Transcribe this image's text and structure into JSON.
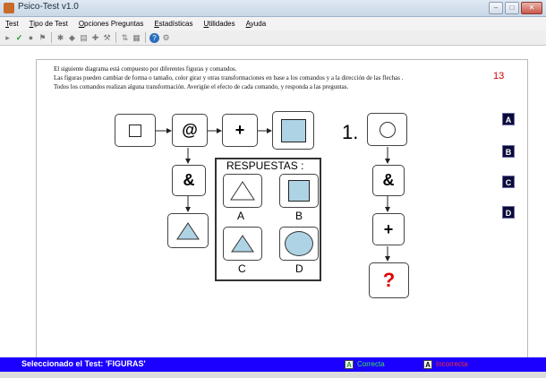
{
  "window": {
    "title": "Psico-Test v1.0"
  },
  "menu": [
    "Test",
    "Tipo de Test",
    "Opciones Preguntas",
    "Estadísticas",
    "Utilidades",
    "Ayuda"
  ],
  "instructions": [
    "El siguiente diagrama está compuesto por diferentes figuras y comandos.",
    "Las figuras pueden cambiar de forma o tamaño, color girar y otras transformaciones en base a los comandos y a la dirección de las flechas .",
    "Todos los comandos realizan alguna transformación. Averigüe el efecto de cada comando, y responda a las preguntas."
  ],
  "question_number": "13",
  "diagram": {
    "cmd_at": "@",
    "cmd_plus": "+",
    "cmd_amp": "&",
    "question_label": "1.",
    "question_mark": "?"
  },
  "answers": {
    "title": "RESPUESTAS :",
    "labels": [
      "A",
      "B",
      "C",
      "D"
    ]
  },
  "side_buttons": [
    "A",
    "B",
    "C",
    "D"
  ],
  "status": {
    "text": "Seleccionado el Test: 'FIGURAS'",
    "correct_icon": "A",
    "correct_label": "Correcta",
    "incorrect_icon": "A",
    "incorrect_label": "Incorrecta"
  },
  "colors": {
    "shape_fill": "#aed3e4",
    "status_bar": "#1b00ff",
    "question_number": "#d40000",
    "correct": "#37e64d",
    "incorrect": "#ff2a2a"
  }
}
